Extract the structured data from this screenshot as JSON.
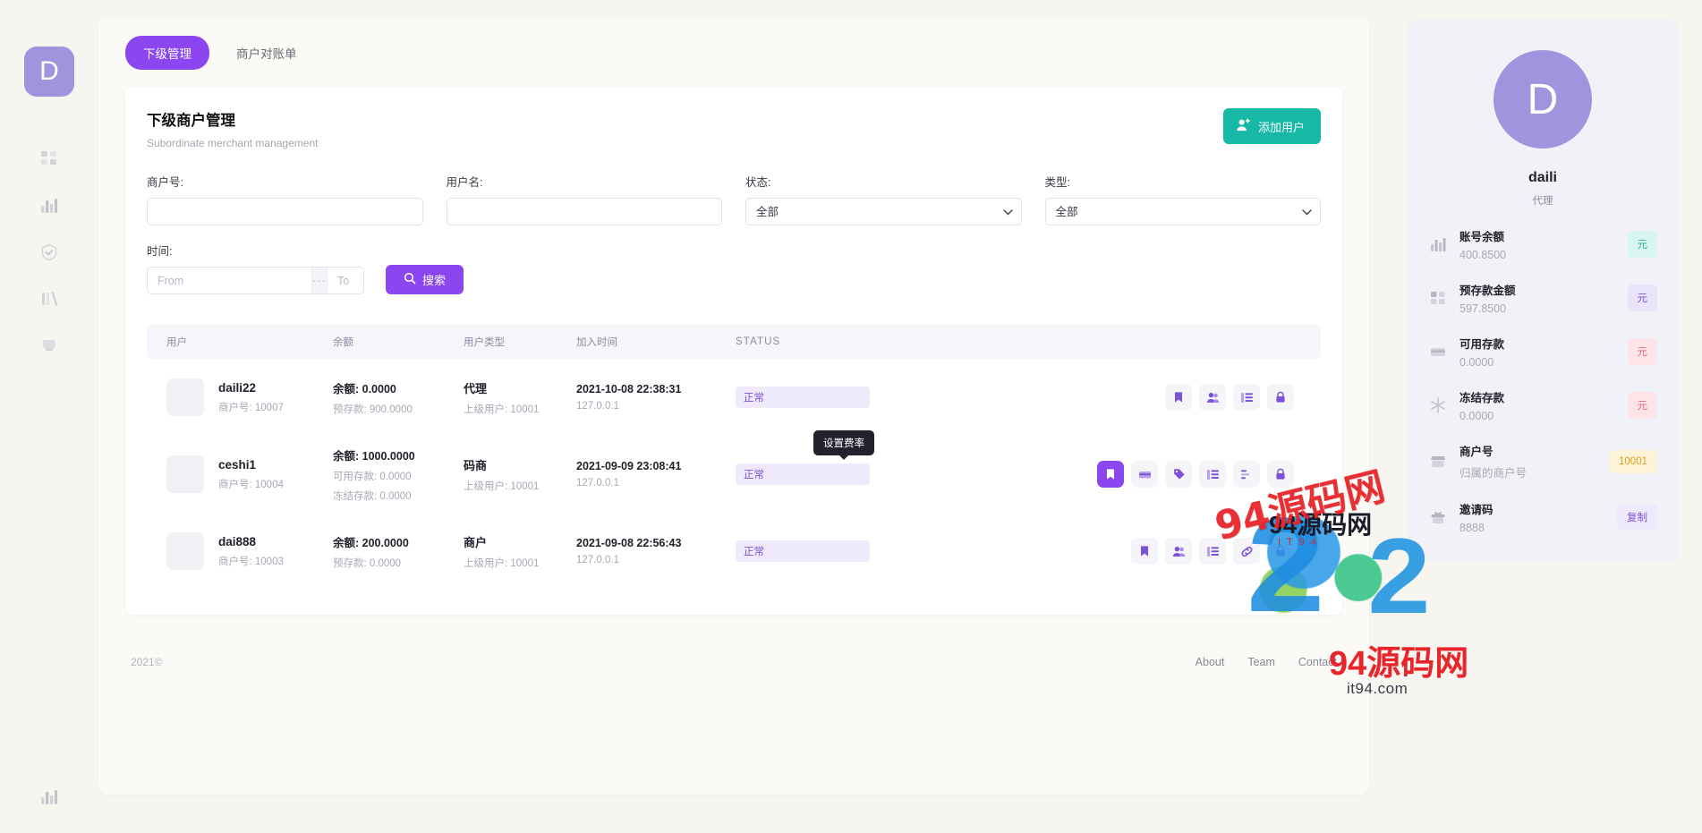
{
  "rail": {
    "logo_letter": "D",
    "icons": [
      {
        "name": "dashboard-grid-icon"
      },
      {
        "name": "bar-chart-icon"
      },
      {
        "name": "check-circle-icon"
      },
      {
        "name": "columns-icon"
      },
      {
        "name": "shield-icon"
      }
    ],
    "bottom_icon": "bar-chart-icon"
  },
  "tabs": [
    {
      "label": "下级管理",
      "active": true
    },
    {
      "label": "商户对账单",
      "active": false
    }
  ],
  "card": {
    "title": "下级商户管理",
    "subtitle": "Subordinate merchant management",
    "add_user_label": "添加用户",
    "add_user_icon": "add-user-icon"
  },
  "filters": {
    "merchant_no": {
      "label": "商户号:",
      "value": "",
      "placeholder": ""
    },
    "username": {
      "label": "用户名:",
      "value": "",
      "placeholder": ""
    },
    "status": {
      "label": "状态:",
      "value": "全部",
      "options": [
        "全部"
      ]
    },
    "type": {
      "label": "类型:",
      "value": "全部",
      "options": [
        "全部"
      ]
    },
    "time": {
      "label": "时间:",
      "from_placeholder": "From",
      "to_placeholder": "To",
      "separator": "···"
    },
    "search_label": "搜索",
    "search_icon": "search-icon"
  },
  "table": {
    "headers": [
      "用户",
      "余额",
      "用户类型",
      "加入时间",
      "STATUS"
    ],
    "rows": [
      {
        "user_name": "daili22",
        "user_sub": "商户号: 10007",
        "amount_main": "余额: 0.0000",
        "amount_sub1": "预存款: 900.0000",
        "amount_sub2": "",
        "type_main": "代理",
        "type_sub": "上级用户: 10001",
        "time_main": "2021-10-08 22:38:31",
        "time_sub": "127.0.0.1",
        "status": "正常",
        "actions": [
          "bookmark-icon",
          "users-icon",
          "list-icon",
          "lock-icon"
        ],
        "active_action": -1
      },
      {
        "user_name": "ceshi1",
        "user_sub": "商户号: 10004",
        "amount_main": "余额: 1000.0000",
        "amount_sub1": "可用存款: 0.0000",
        "amount_sub2": "冻结存款: 0.0000",
        "type_main": "码商",
        "type_sub": "上级用户: 10001",
        "time_main": "2021-09-09 23:08:41",
        "time_sub": "127.0.0.1",
        "status": "正常",
        "actions": [
          "bookmark-icon",
          "card-icon",
          "tag-icon",
          "list-icon",
          "chart-icon",
          "lock-icon"
        ],
        "active_action": 0,
        "tooltip": "设置费率"
      },
      {
        "user_name": "dai888",
        "user_sub": "商户号: 10003",
        "amount_main": "余额: 200.0000",
        "amount_sub1": "预存款: 0.0000",
        "amount_sub2": "",
        "type_main": "商户",
        "type_sub": "上级用户: 10001",
        "time_main": "2021-09-08 22:56:43",
        "time_sub": "127.0.0.1",
        "status": "正常",
        "actions": [
          "bookmark-icon",
          "users-icon",
          "list-icon",
          "link-icon",
          "lock-icon"
        ],
        "active_action": -1
      }
    ]
  },
  "footer": {
    "copyright": "2021©",
    "links": [
      "About",
      "Team",
      "Contact"
    ]
  },
  "profile": {
    "avatar_letter": "D",
    "name": "daili",
    "role": "代理",
    "stats": [
      {
        "icon": "bar-chart-icon",
        "label": "账号余额",
        "value": "400.8500",
        "pill": "元",
        "pill_style": "teal"
      },
      {
        "icon": "grid-icon",
        "label": "预存款金额",
        "value": "597.8500",
        "pill": "元",
        "pill_style": "purple"
      },
      {
        "icon": "card-icon",
        "label": "可用存款",
        "value": "0.0000",
        "pill": "元",
        "pill_style": "pink"
      },
      {
        "icon": "snowflake-icon",
        "label": "冻结存款",
        "value": "0.0000",
        "pill": "元",
        "pill_style": "pink"
      },
      {
        "icon": "store-icon",
        "label": "商户号",
        "value": "归属的商户号",
        "pill": "10001",
        "pill_style": "amber"
      },
      {
        "icon": "gift-icon",
        "label": "邀请码",
        "value": "8888",
        "pill": "复制",
        "pill_style": "lilac"
      }
    ]
  },
  "watermark": {
    "site_cn": "94源码网",
    "site_cn2": "94源码网",
    "site_url": "it94.com",
    "tiny": "I T 9 4"
  },
  "colors": {
    "accent_purple": "#8b46f0",
    "accent_teal": "#17b8a6",
    "avatar_purple": "#a193de",
    "page_bg": "#f7f5f0"
  }
}
